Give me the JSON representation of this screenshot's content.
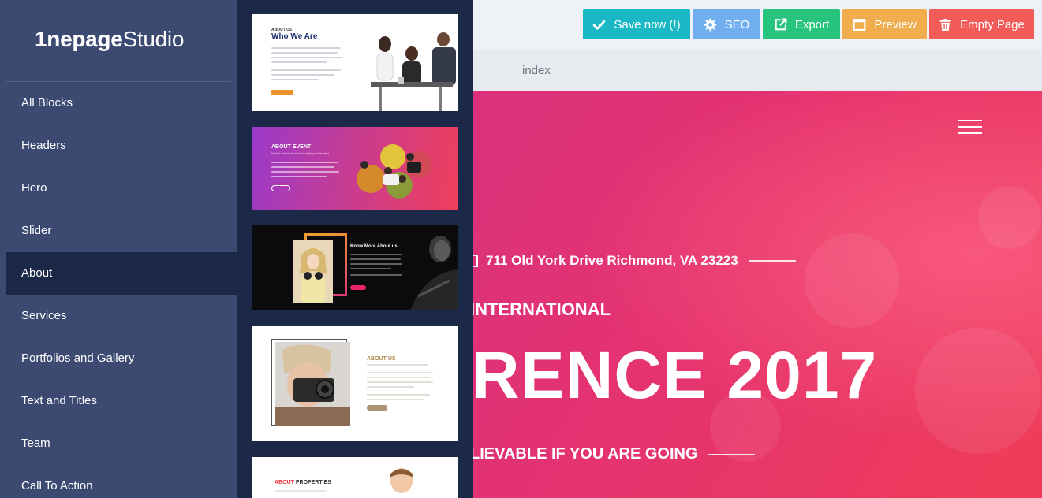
{
  "app": {
    "logo_one": "1",
    "logo_rest_bold": "nepage",
    "logo_light": "Studio"
  },
  "sidebar": {
    "items": [
      {
        "label": "All Blocks"
      },
      {
        "label": "Headers"
      },
      {
        "label": "Hero"
      },
      {
        "label": "Slider"
      },
      {
        "label": "About",
        "active": true
      },
      {
        "label": "Services"
      },
      {
        "label": "Portfolios and Gallery"
      },
      {
        "label": "Text and Titles"
      },
      {
        "label": "Team"
      },
      {
        "label": "Call To Action"
      }
    ]
  },
  "toolbar": {
    "save_label": "Save now (!)",
    "seo_label": "SEO",
    "export_label": "Export",
    "preview_label": "Preview",
    "empty_label": "Empty Page",
    "colors": {
      "save": "#1ab7c4",
      "seo": "#71aef0",
      "export": "#27c47e",
      "preview": "#f0ad4e",
      "empty": "#f15b58"
    }
  },
  "tabs": {
    "active": "index"
  },
  "thumbnails": [
    {
      "kicker": "ABOUT US",
      "title": "Who We Are"
    },
    {
      "title": "ABOUT EVENT",
      "subtitle": "Words which don't look slightly believable"
    },
    {
      "title": "Know More About us"
    },
    {
      "title": "ABOUT US"
    },
    {
      "title_a": "ABOUT",
      "title_b": "PROPERTIES"
    }
  ],
  "canvas": {
    "address": "711 Old York Drive Richmond, VA 23223",
    "subtitle": "INTERNATIONAL",
    "title": "RENCE 2017",
    "tagline": "LIEVABLE IF YOU ARE GOING"
  },
  "icons": {
    "save": "check-icon",
    "seo": "gear-icon",
    "export": "external-link-icon",
    "preview": "window-icon",
    "empty": "trash-icon",
    "menu": "hamburger-icon"
  }
}
